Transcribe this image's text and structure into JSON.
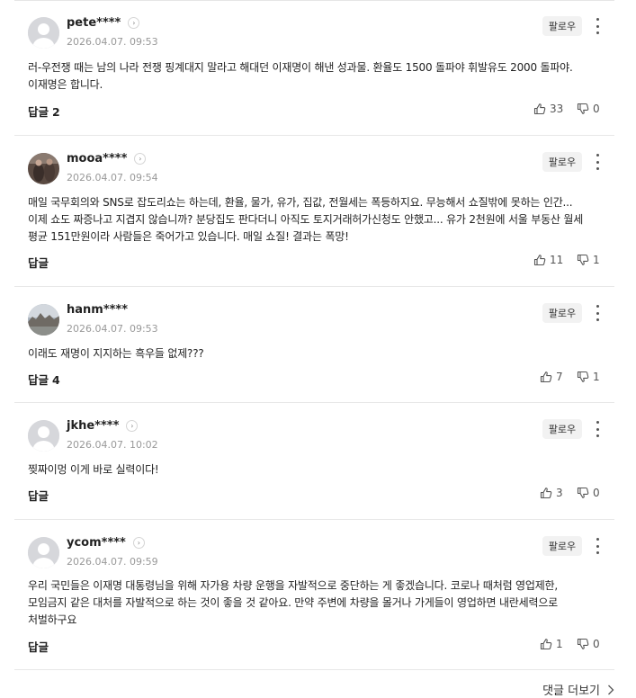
{
  "follow_label": "팔로우",
  "more_comments_label": "댓글 더보기",
  "comments": [
    {
      "username": "pete****",
      "timestamp": "2026.04.07. 09:53",
      "avatar": "default-avatar",
      "text": "러-우전쟁 때는 남의 나라 전쟁 핑계대지 말라고 해대던 이재명이 해낸 성과물. 환율도 1500 돌파야 휘발유도 2000 돌파야. 이재명은 합니다.",
      "reply_label": "답글",
      "reply_count": "2",
      "likes": "33",
      "dislikes": "0"
    },
    {
      "username": "mooa****",
      "timestamp": "2026.04.07. 09:54",
      "avatar": "photo-avatar-dark",
      "text": "매일 국무회의와 SNS로 잡도리쇼는 하는데, 환율, 물가, 유가, 집값, 전월세는 폭등하지요. 무능해서 쇼질밖에 못하는 인간... 이제 쇼도 짜증나고 지겹지 않습니까? 분당집도 판다더니 아직도 토지거래허가신청도 안했고... 유가 2천원에 서울 부동산 월세 평균 151만원이라 사람들은 죽어가고 있습니다. 매일 쇼질! 결과는 폭망!",
      "reply_label": "답글",
      "reply_count": "",
      "likes": "11",
      "dislikes": "1"
    },
    {
      "username": "hanm****",
      "timestamp": "2026.04.07. 09:53",
      "avatar": "photo-avatar-landscape",
      "text": "이래도 재명이 지지하는 흑우들 없제???",
      "reply_label": "답글",
      "reply_count": "4",
      "likes": "7",
      "dislikes": "1"
    },
    {
      "username": "jkhe****",
      "timestamp": "2026.04.07. 10:02",
      "avatar": "default-avatar",
      "text": "찢짜이멍 이게 바로 실력이다!",
      "reply_label": "답글",
      "reply_count": "",
      "likes": "3",
      "dislikes": "0"
    },
    {
      "username": "ycom****",
      "timestamp": "2026.04.07. 09:59",
      "avatar": "default-avatar",
      "text": "우리 국민들은 이재명 대통령님을 위해 자가용 차량 운행을 자발적으로 중단하는 게 좋겠습니다. 코로나 때처럼 영업제한, 모임금지 같은 대처를 자발적으로 하는 것이 좋을 것 같아요. 만약 주변에 차량을 몰거나 가게들이 영업하면 내란세력으로 처벌하구요",
      "reply_label": "답글",
      "reply_count": "",
      "likes": "1",
      "dislikes": "0"
    }
  ]
}
